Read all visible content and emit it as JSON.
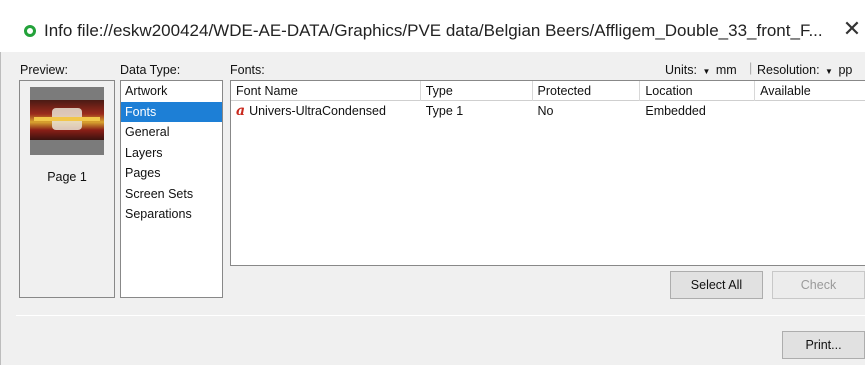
{
  "window": {
    "title": "Info file://eskw200424/WDE-AE-DATA/Graphics/PVE data/Belgian Beers/Affligem_Double_33_front_F...",
    "close_glyph": "✕"
  },
  "labels": {
    "preview": "Preview:",
    "data_type": "Data Type:",
    "fonts": "Fonts:",
    "units_prefix": "Units:",
    "units_value": "mm",
    "resolution_prefix": "Resolution:",
    "resolution_value": "pp"
  },
  "preview": {
    "page_label": "Page 1"
  },
  "data_types": {
    "items": [
      "Artwork",
      "Fonts",
      "General",
      "Layers",
      "Pages",
      "Screen Sets",
      "Separations"
    ],
    "selected": "Fonts"
  },
  "fonts_table": {
    "columns": [
      "Font Name",
      "Type",
      "Protected",
      "Location",
      "Available"
    ],
    "rows": [
      {
        "icon": "font-type-icon",
        "name": "Univers-UltraCondensed",
        "type": "Type 1",
        "protected": "No",
        "location": "Embedded",
        "available": ""
      }
    ]
  },
  "buttons": {
    "select_all": "Select All",
    "check": "Check",
    "print": "Print..."
  },
  "colors": {
    "selection": "#1d7fd6",
    "status_icon": "#23a23a",
    "font_icon": "#c9291d"
  }
}
